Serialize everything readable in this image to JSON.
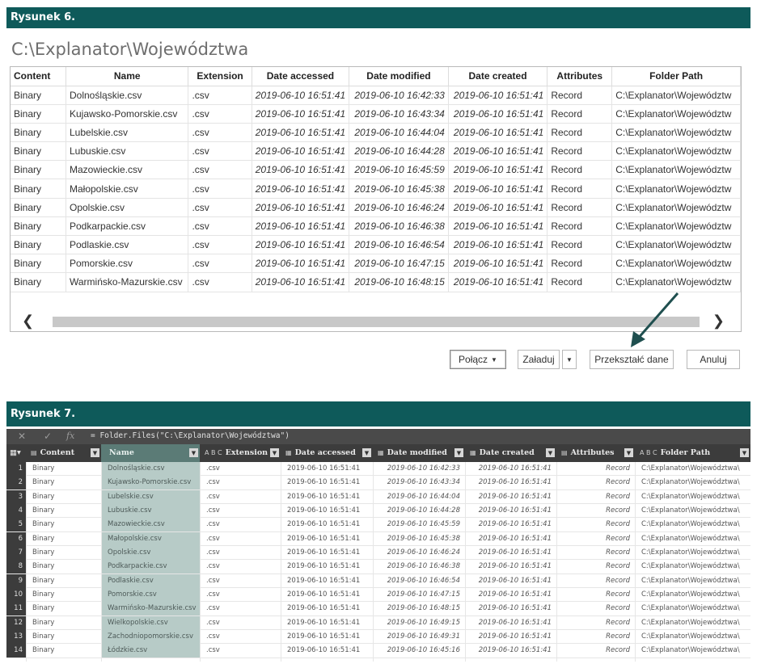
{
  "figure6": {
    "banner": "Rysunek 6.",
    "title": "C:\\Explanator\\Województwa",
    "columns": [
      "Content",
      "Name",
      "Extension",
      "Date accessed",
      "Date modified",
      "Date created",
      "Attributes",
      "Folder Path"
    ],
    "rows": [
      [
        "Binary",
        "Dolnośląskie.csv",
        ".csv",
        "2019-06-10 16:51:41",
        "2019-06-10 16:42:33",
        "2019-06-10 16:51:41",
        "Record",
        "C:\\Explanator\\Województw"
      ],
      [
        "Binary",
        "Kujawsko-Pomorskie.csv",
        ".csv",
        "2019-06-10 16:51:41",
        "2019-06-10 16:43:34",
        "2019-06-10 16:51:41",
        "Record",
        "C:\\Explanator\\Województw"
      ],
      [
        "Binary",
        "Lubelskie.csv",
        ".csv",
        "2019-06-10 16:51:41",
        "2019-06-10 16:44:04",
        "2019-06-10 16:51:41",
        "Record",
        "C:\\Explanator\\Województw"
      ],
      [
        "Binary",
        "Lubuskie.csv",
        ".csv",
        "2019-06-10 16:51:41",
        "2019-06-10 16:44:28",
        "2019-06-10 16:51:41",
        "Record",
        "C:\\Explanator\\Województw"
      ],
      [
        "Binary",
        "Mazowieckie.csv",
        ".csv",
        "2019-06-10 16:51:41",
        "2019-06-10 16:45:59",
        "2019-06-10 16:51:41",
        "Record",
        "C:\\Explanator\\Województw"
      ],
      [
        "Binary",
        "Małopolskie.csv",
        ".csv",
        "2019-06-10 16:51:41",
        "2019-06-10 16:45:38",
        "2019-06-10 16:51:41",
        "Record",
        "C:\\Explanator\\Województw"
      ],
      [
        "Binary",
        "Opolskie.csv",
        ".csv",
        "2019-06-10 16:51:41",
        "2019-06-10 16:46:24",
        "2019-06-10 16:51:41",
        "Record",
        "C:\\Explanator\\Województw"
      ],
      [
        "Binary",
        "Podkarpackie.csv",
        ".csv",
        "2019-06-10 16:51:41",
        "2019-06-10 16:46:38",
        "2019-06-10 16:51:41",
        "Record",
        "C:\\Explanator\\Województw"
      ],
      [
        "Binary",
        "Podlaskie.csv",
        ".csv",
        "2019-06-10 16:51:41",
        "2019-06-10 16:46:54",
        "2019-06-10 16:51:41",
        "Record",
        "C:\\Explanator\\Województw"
      ],
      [
        "Binary",
        "Pomorskie.csv",
        ".csv",
        "2019-06-10 16:51:41",
        "2019-06-10 16:47:15",
        "2019-06-10 16:51:41",
        "Record",
        "C:\\Explanator\\Województw"
      ],
      [
        "Binary",
        "Warmińsko-Mazurskie.csv",
        ".csv",
        "2019-06-10 16:51:41",
        "2019-06-10 16:48:15",
        "2019-06-10 16:51:41",
        "Record",
        "C:\\Explanator\\Województw"
      ]
    ],
    "buttons": {
      "polacz": "Połącz",
      "zaladuj": "Załaduj",
      "przeksztalc": "Przekształć dane",
      "anuluj": "Anuluj"
    }
  },
  "figure7": {
    "banner": "Rysunek 7.",
    "formula": "= Folder.Files(\"C:\\Explanator\\Województwa\")",
    "fx": "fx",
    "columns": [
      {
        "label": "Content",
        "type": "▤"
      },
      {
        "label": "Name",
        "type": ""
      },
      {
        "label": "Extension",
        "type": "A B C"
      },
      {
        "label": "Date accessed",
        "type": "▦"
      },
      {
        "label": "Date modified",
        "type": "▦"
      },
      {
        "label": "Date created",
        "type": "▦"
      },
      {
        "label": "Attributes",
        "type": "▤"
      },
      {
        "label": "Folder Path",
        "type": "A B C"
      }
    ],
    "rows": [
      [
        "1",
        "Binary",
        "Dolnośląskie.csv",
        ".csv",
        "2019-06-10 16:51:41",
        "2019-06-10 16:42:33",
        "2019-06-10 16:51:41",
        "Record",
        "C:\\Explanator\\Województwa\\"
      ],
      [
        "2",
        "Binary",
        "Kujawsko-Pomorskie.csv",
        ".csv",
        "2019-06-10 16:51:41",
        "2019-06-10 16:43:34",
        "2019-06-10 16:51:41",
        "Record",
        "C:\\Explanator\\Województwa\\"
      ],
      [
        "3",
        "Binary",
        "Lubelskie.csv",
        ".csv",
        "2019-06-10 16:51:41",
        "2019-06-10 16:44:04",
        "2019-06-10 16:51:41",
        "Record",
        "C:\\Explanator\\Województwa\\"
      ],
      [
        "4",
        "Binary",
        "Lubuskie.csv",
        ".csv",
        "2019-06-10 16:51:41",
        "2019-06-10 16:44:28",
        "2019-06-10 16:51:41",
        "Record",
        "C:\\Explanator\\Województwa\\"
      ],
      [
        "5",
        "Binary",
        "Mazowieckie.csv",
        ".csv",
        "2019-06-10 16:51:41",
        "2019-06-10 16:45:59",
        "2019-06-10 16:51:41",
        "Record",
        "C:\\Explanator\\Województwa\\"
      ],
      [
        "6",
        "Binary",
        "Małopolskie.csv",
        ".csv",
        "2019-06-10 16:51:41",
        "2019-06-10 16:45:38",
        "2019-06-10 16:51:41",
        "Record",
        "C:\\Explanator\\Województwa\\"
      ],
      [
        "7",
        "Binary",
        "Opolskie.csv",
        ".csv",
        "2019-06-10 16:51:41",
        "2019-06-10 16:46:24",
        "2019-06-10 16:51:41",
        "Record",
        "C:\\Explanator\\Województwa\\"
      ],
      [
        "8",
        "Binary",
        "Podkarpackie.csv",
        ".csv",
        "2019-06-10 16:51:41",
        "2019-06-10 16:46:38",
        "2019-06-10 16:51:41",
        "Record",
        "C:\\Explanator\\Województwa\\"
      ],
      [
        "9",
        "Binary",
        "Podlaskie.csv",
        ".csv",
        "2019-06-10 16:51:41",
        "2019-06-10 16:46:54",
        "2019-06-10 16:51:41",
        "Record",
        "C:\\Explanator\\Województwa\\"
      ],
      [
        "10",
        "Binary",
        "Pomorskie.csv",
        ".csv",
        "2019-06-10 16:51:41",
        "2019-06-10 16:47:15",
        "2019-06-10 16:51:41",
        "Record",
        "C:\\Explanator\\Województwa\\"
      ],
      [
        "11",
        "Binary",
        "Warmińsko-Mazurskie.csv",
        ".csv",
        "2019-06-10 16:51:41",
        "2019-06-10 16:48:15",
        "2019-06-10 16:51:41",
        "Record",
        "C:\\Explanator\\Województwa\\"
      ],
      [
        "12",
        "Binary",
        "Wielkopolskie.csv",
        ".csv",
        "2019-06-10 16:51:41",
        "2019-06-10 16:49:15",
        "2019-06-10 16:51:41",
        "Record",
        "C:\\Explanator\\Województwa\\"
      ],
      [
        "13",
        "Binary",
        "Zachodniopomorskie.csv",
        ".csv",
        "2019-06-10 16:51:41",
        "2019-06-10 16:49:31",
        "2019-06-10 16:51:41",
        "Record",
        "C:\\Explanator\\Województwa\\"
      ],
      [
        "14",
        "Binary",
        "Łódzkie.csv",
        ".csv",
        "2019-06-10 16:51:41",
        "2019-06-10 16:45:16",
        "2019-06-10 16:51:41",
        "Record",
        "C:\\Explanator\\Województwa\\"
      ]
    ]
  },
  "colors": {
    "banner": "#0e5a5a",
    "pq_header": "#3c3c3c",
    "name_column": "#b7cbc7",
    "arrow": "#1f4f4f"
  }
}
